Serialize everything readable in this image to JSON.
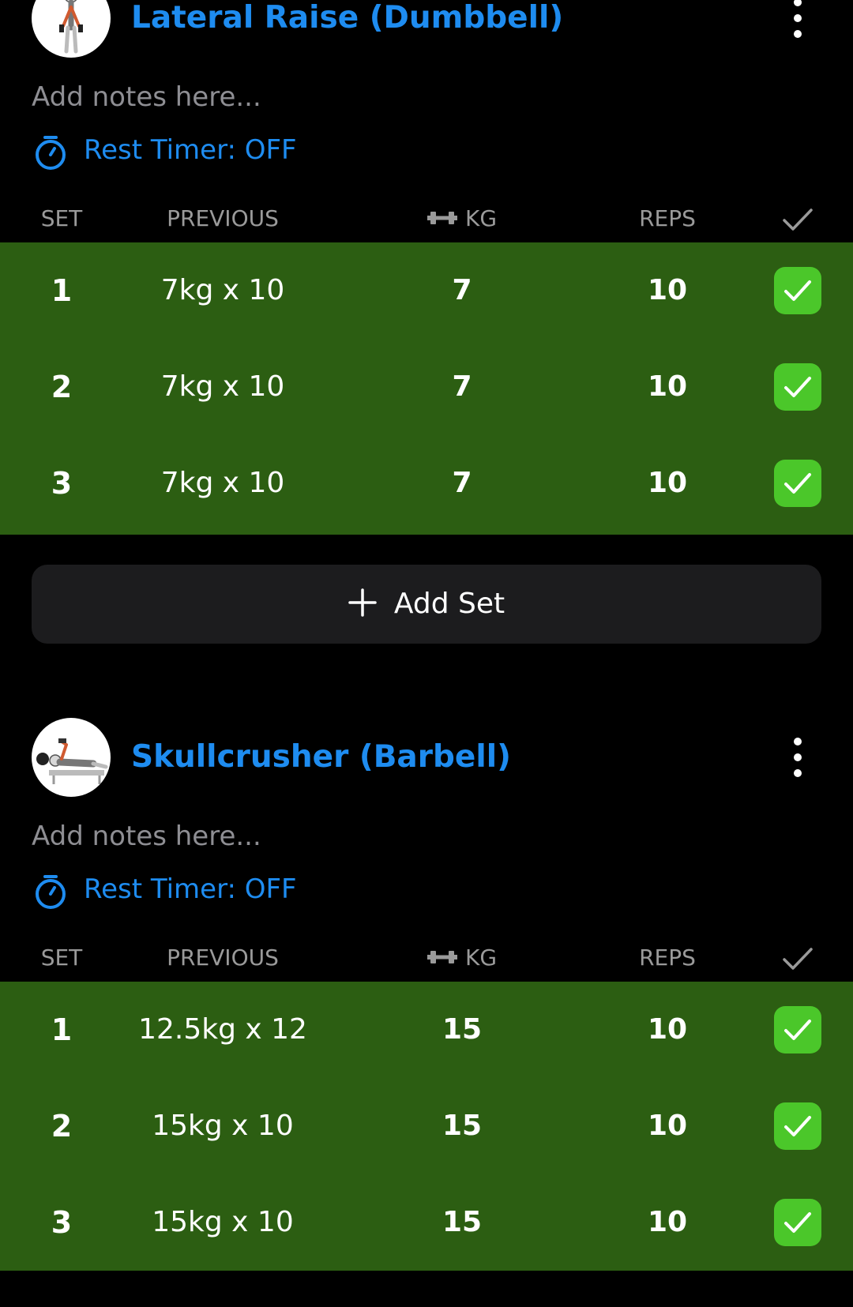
{
  "exercises": [
    {
      "title": "Lateral Raise (Dumbbell)",
      "notes_placeholder": "Add notes here...",
      "rest_timer": "Rest Timer: OFF",
      "columns": {
        "set": "SET",
        "previous": "PREVIOUS",
        "kg": "KG",
        "reps": "REPS"
      },
      "sets": [
        {
          "set": "1",
          "previous": "7kg x 10",
          "kg": "7",
          "reps": "10",
          "completed": true
        },
        {
          "set": "2",
          "previous": "7kg x 10",
          "kg": "7",
          "reps": "10",
          "completed": true
        },
        {
          "set": "3",
          "previous": "7kg x 10",
          "kg": "7",
          "reps": "10",
          "completed": true
        }
      ],
      "add_set_label": "Add Set"
    },
    {
      "title": "Skullcrusher (Barbell)",
      "notes_placeholder": "Add notes here...",
      "rest_timer": "Rest Timer: OFF",
      "columns": {
        "set": "SET",
        "previous": "PREVIOUS",
        "kg": "KG",
        "reps": "REPS"
      },
      "sets": [
        {
          "set": "1",
          "previous": "12.5kg x 12",
          "kg": "15",
          "reps": "10",
          "completed": true
        },
        {
          "set": "2",
          "previous": "15kg x 10",
          "kg": "15",
          "reps": "10",
          "completed": true
        },
        {
          "set": "3",
          "previous": "15kg x 10",
          "kg": "15",
          "reps": "10",
          "completed": true
        }
      ]
    }
  ],
  "icons": {
    "more": "more-vertical-icon",
    "timer": "stopwatch-icon",
    "kg": "dumbbell-icon",
    "check": "checkmark-icon",
    "add": "plus-icon"
  },
  "colors": {
    "accent": "#1e8cf0",
    "completed_row": "#2c5e12",
    "checkbox": "#4bc72a",
    "background": "#000000",
    "muted_text": "#8e8e93",
    "button_bg": "#1c1c1e"
  }
}
